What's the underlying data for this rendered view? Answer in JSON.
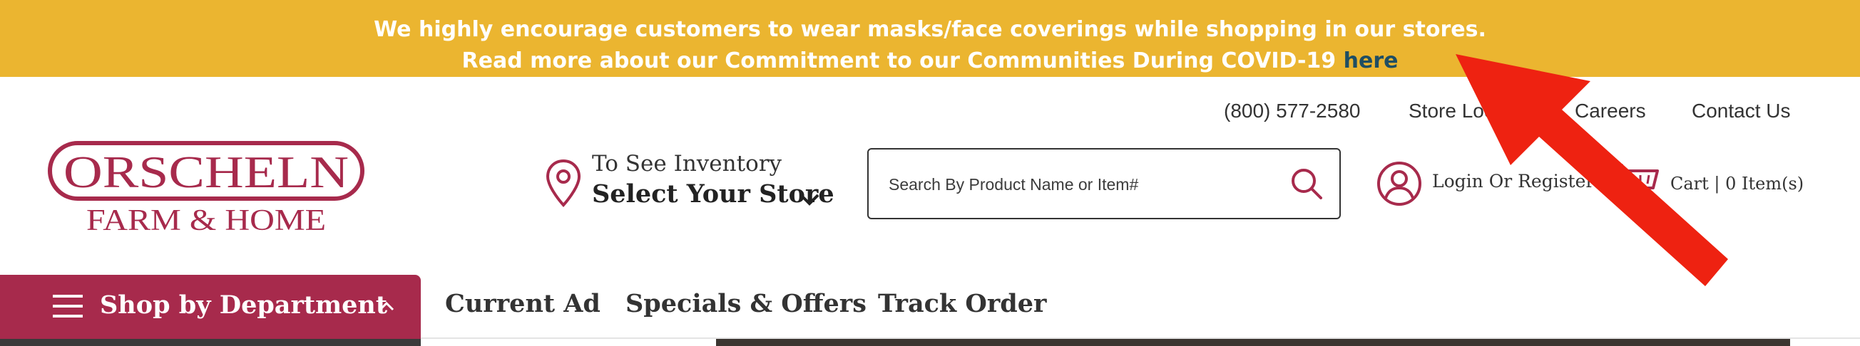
{
  "banner": {
    "line1": "We highly encourage customers to wear masks/face coverings while shopping in our stores.",
    "line2_text": "Read more about our Commitment to our Communities During COVID-19 ",
    "line2_link": "here",
    "background": "#ebb530",
    "link_color": "#1f4e63"
  },
  "utility_links": {
    "phone": "(800) 577-2580",
    "store_locator": "Store Locator",
    "careers": "Careers",
    "contact_us": "Contact Us"
  },
  "logo": {
    "brand_name": "ORSCHELN",
    "tagline": "FARM & HOME",
    "color": "#a72a4c"
  },
  "store_selector": {
    "line1": "To See Inventory",
    "line2": "Select Your Store",
    "icon": "location-pin-icon"
  },
  "search": {
    "placeholder": "Search By Product Name or Item#",
    "value": "",
    "icon": "search-icon"
  },
  "account": {
    "label": "Login Or Register",
    "icon": "user-icon"
  },
  "cart": {
    "label": "Cart | 0 Item(s)",
    "icon": "cart-icon"
  },
  "nav": {
    "department_button": "Shop by Department",
    "links": [
      "Current Ad",
      "Specials & Offers",
      "Track Order"
    ],
    "accent": "#a72a4c"
  },
  "annotation": {
    "type": "arrow",
    "color": "#ee2211",
    "icon": "red-arrow-icon"
  }
}
